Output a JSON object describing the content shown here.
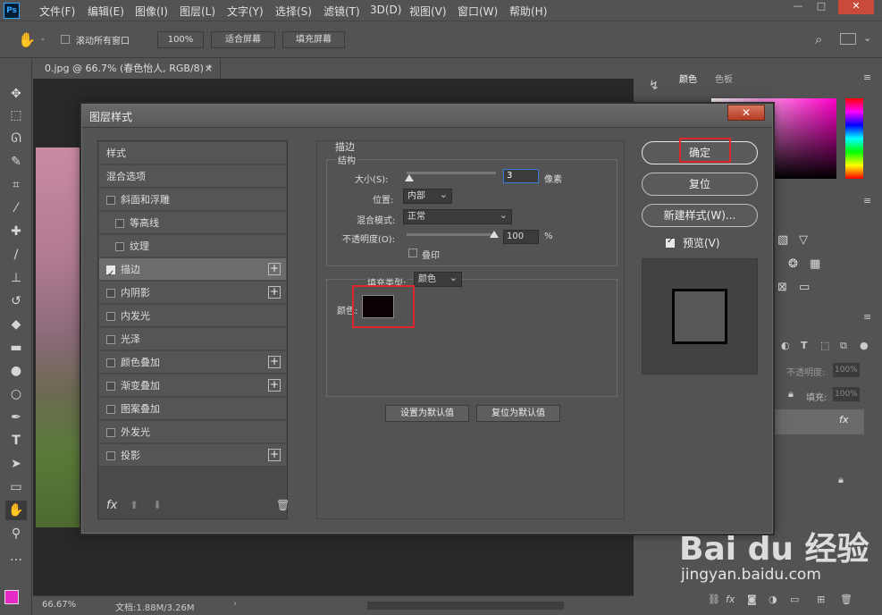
{
  "app": {
    "logo": "Ps",
    "menu": [
      "文件(F)",
      "编辑(E)",
      "图像(I)",
      "图层(L)",
      "文字(Y)",
      "选择(S)",
      "滤镜(T)",
      "3D(D)",
      "视图(V)",
      "窗口(W)",
      "帮助(H)"
    ],
    "window_controls": [
      "—",
      "□",
      "✕"
    ]
  },
  "options_bar": {
    "scroll_all_label": "滚动所有窗口",
    "zoom_value": "100%",
    "fit_screen": "适合屏幕",
    "fill_screen": "填充屏幕"
  },
  "document": {
    "tab_title": "0.jpg @ 66.7% (春色怡人, RGB/8) *",
    "tab_close": "×",
    "status_zoom": "66.67%",
    "status_doc": "文档:1.88M/3.26M"
  },
  "dialog": {
    "title": "图层样式",
    "close": "✕",
    "styles_header": "样式",
    "blend_options": "混合选项",
    "items": [
      {
        "label": "斜面和浮雕",
        "checked": false,
        "plus": false,
        "indent": false
      },
      {
        "label": "等高线",
        "checked": false,
        "plus": false,
        "indent": true
      },
      {
        "label": "纹理",
        "checked": false,
        "plus": false,
        "indent": true
      },
      {
        "label": "描边",
        "checked": true,
        "plus": true,
        "indent": false,
        "selected": true
      },
      {
        "label": "内阴影",
        "checked": false,
        "plus": true,
        "indent": false
      },
      {
        "label": "内发光",
        "checked": false,
        "plus": false,
        "indent": false
      },
      {
        "label": "光泽",
        "checked": false,
        "plus": false,
        "indent": false
      },
      {
        "label": "颜色叠加",
        "checked": false,
        "plus": true,
        "indent": false
      },
      {
        "label": "渐变叠加",
        "checked": false,
        "plus": true,
        "indent": false
      },
      {
        "label": "图案叠加",
        "checked": false,
        "plus": false,
        "indent": false
      },
      {
        "label": "外发光",
        "checked": false,
        "plus": false,
        "indent": false
      },
      {
        "label": "投影",
        "checked": false,
        "plus": true,
        "indent": false
      }
    ],
    "footer_fx": "fx",
    "stroke": {
      "section_title": "描边",
      "structure_title": "结构",
      "size_label": "大小(S):",
      "size_value": "3",
      "size_unit": "像素",
      "position_label": "位置:",
      "position_value": "内部",
      "blend_label": "混合模式:",
      "blend_value": "正常",
      "opacity_label": "不透明度(O):",
      "opacity_value": "100",
      "opacity_unit": "%",
      "emboss_label": "叠印",
      "fill_type_label": "填充类型:",
      "fill_type_value": "颜色",
      "color_label": "颜色:",
      "color_value": "#0b0002",
      "set_default": "设置为默认值",
      "reset_default": "复位为默认值"
    },
    "buttons": {
      "ok": "确定",
      "reset": "复位",
      "new_style": "新建样式(W)...",
      "preview": "预览(V)"
    }
  },
  "panels": {
    "color_tab": "颜色",
    "swatches_tab": "色板",
    "layers_opacity_label": "不透明度:",
    "layers_opacity_value": "100%",
    "layers_fill_label": "填充:",
    "layers_fill_value": "100%"
  },
  "watermark": {
    "brand": "Bai du 经验",
    "url": "jingyan.baidu.com"
  }
}
